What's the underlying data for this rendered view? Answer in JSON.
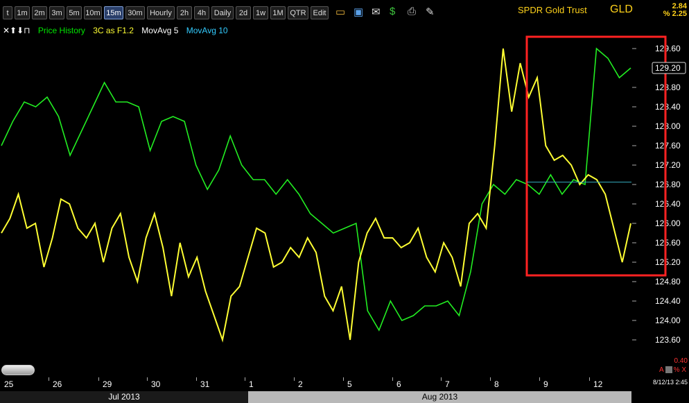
{
  "toolbar": {
    "intervals": [
      "t",
      "1m",
      "2m",
      "3m",
      "5m",
      "10m",
      "15m",
      "30m",
      "Hourly",
      "2h",
      "4h",
      "Daily",
      "2d",
      "1w",
      "1M",
      "QTR",
      "Edit"
    ],
    "active_interval": "15m",
    "icons": [
      "folder-icon",
      "save-icon",
      "mail-icon",
      "dollar-icon",
      "print-icon",
      "pencil-icon"
    ]
  },
  "symbol": {
    "name": "SPDR Gold Trust",
    "ticker": "GLD",
    "change_1": "2.84",
    "change_2": "% 2.25"
  },
  "legend": {
    "controls": "✕⬆⬇⊓",
    "items": [
      {
        "label": "Price History",
        "color": "#00e600"
      },
      {
        "label": "3C as F1.2",
        "color": "#ffff33"
      },
      {
        "label": "MovAvg 5",
        "color": "#ffffff"
      },
      {
        "label": "MovAvg 10",
        "color": "#33ccff"
      }
    ]
  },
  "chart_data": {
    "type": "line",
    "title": "SPDR Gold Trust",
    "ylim": [
      123.4,
      129.9
    ],
    "y_ticks": [
      "129.60",
      "128.80",
      "128.40",
      "128.00",
      "127.60",
      "127.20",
      "126.80",
      "126.40",
      "126.00",
      "125.60",
      "125.20",
      "124.80",
      "124.40",
      "124.00",
      "123.60"
    ],
    "current_price_label": "129.20",
    "x_days": [
      "25",
      "26",
      "29",
      "30",
      "31",
      "1",
      "2",
      "5",
      "6",
      "7",
      "8",
      "9",
      "12"
    ],
    "months": [
      "Jul 2013",
      "Aug 2013"
    ],
    "series": [
      {
        "name": "Price History",
        "color": "#22ee22",
        "values": [
          127.6,
          128.1,
          128.5,
          128.4,
          128.6,
          128.2,
          127.4,
          127.9,
          128.4,
          128.9,
          128.5,
          128.5,
          128.4,
          127.5,
          128.1,
          128.2,
          128.1,
          127.2,
          126.7,
          127.1,
          127.8,
          127.2,
          126.9,
          126.9,
          126.6,
          126.9,
          126.6,
          126.2,
          126.0,
          125.8,
          125.9,
          126.0,
          124.2,
          123.8,
          124.4,
          124.0,
          124.1,
          124.3,
          124.3,
          124.4,
          124.1,
          125.0,
          126.4,
          126.8,
          126.6,
          126.9,
          126.8,
          126.6,
          127.0,
          126.6,
          126.9,
          126.8,
          129.6,
          129.4,
          129.0,
          129.2
        ]
      },
      {
        "name": "3C as F1.2",
        "color": "#ffff33",
        "values": [
          125.8,
          126.1,
          126.6,
          125.9,
          126.0,
          125.1,
          125.7,
          126.5,
          126.4,
          125.9,
          125.7,
          126.0,
          125.2,
          125.9,
          126.2,
          125.3,
          124.8,
          125.7,
          126.2,
          125.5,
          124.5,
          125.6,
          124.9,
          125.3,
          124.6,
          124.1,
          123.6,
          124.5,
          124.7,
          125.3,
          125.9,
          125.8,
          125.1,
          125.2,
          125.5,
          125.3,
          125.7,
          125.4,
          124.5,
          124.2,
          124.7,
          123.6,
          125.2,
          125.8,
          126.1,
          125.7,
          125.7,
          125.5,
          125.6,
          125.9,
          125.3,
          125.0,
          125.6,
          125.3,
          124.7,
          126.0,
          126.2,
          125.9,
          127.6,
          129.6,
          128.3,
          129.3,
          128.6,
          129.0,
          127.6,
          127.3,
          127.4,
          127.2,
          126.8,
          127.0,
          126.9,
          126.6,
          125.9,
          125.2,
          126.0
        ]
      }
    ],
    "highlight_box": {
      "color": "#ff2222"
    },
    "grid": false
  },
  "indicator": {
    "value": "0.40",
    "controls_left": "A",
    "controls_right": "% X"
  },
  "timestamp": "8/12/13 2:45"
}
